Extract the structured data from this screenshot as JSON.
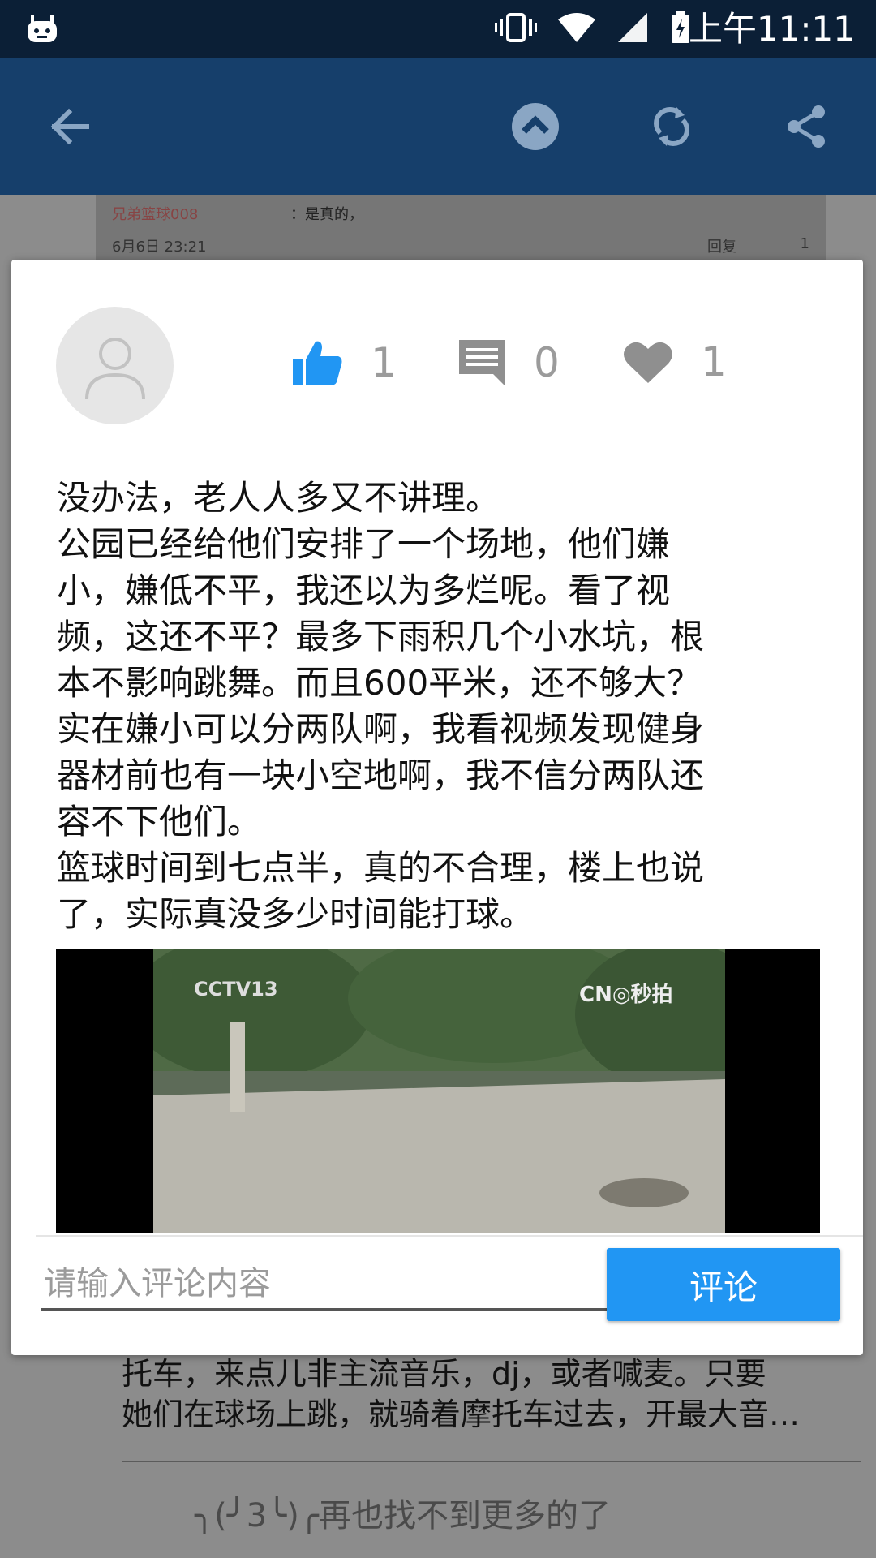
{
  "status_bar": {
    "time": "上午11:11"
  },
  "background": {
    "comment": {
      "user": "兄弟篮球008",
      "text": "：是真的，",
      "date": "6月6日 23:21",
      "reply": "回复",
      "likes": "1"
    },
    "bottom_text": "托车，来点儿非主流音乐，dj，或者喊麦。只要\n她们在球场上跳，就骑着摩托车过去，开最大音…",
    "end_message": "╮(╯3╰)╭再也找不到更多的了"
  },
  "dialog": {
    "stats": {
      "likes": "1",
      "comments": "0",
      "favorites": "1"
    },
    "content": "没办法，老人人多又不讲理。\n公园已经给他们安排了一个场地，他们嫌\n小，嫌低不平，我还以为多烂呢。看了视\n频，这还不平？最多下雨积几个小水坑，根\n本不影响跳舞。而且600平米，还不够大？\n实在嫌小可以分两队啊，我看视频发现健身\n器材前也有一块小空地啊，我不信分两队还\n容不下他们。\n篮球时间到七点半，真的不合理，楼上也说\n了，实际真没多少时间能打球。",
    "video": {
      "logo_left": "CCTV13",
      "logo_right": "CN◎秒拍"
    },
    "input": {
      "placeholder": "请输入评论内容",
      "value": ""
    },
    "submit_label": "评论"
  },
  "colors": {
    "accent": "#2196f3",
    "toolbar": "#163f6b",
    "statusbar": "#0b1f36"
  },
  "icons": [
    "back-arrow-icon",
    "scroll-top-icon",
    "refresh-icon",
    "share-icon",
    "thumb-up-icon",
    "comment-icon",
    "heart-icon"
  ]
}
